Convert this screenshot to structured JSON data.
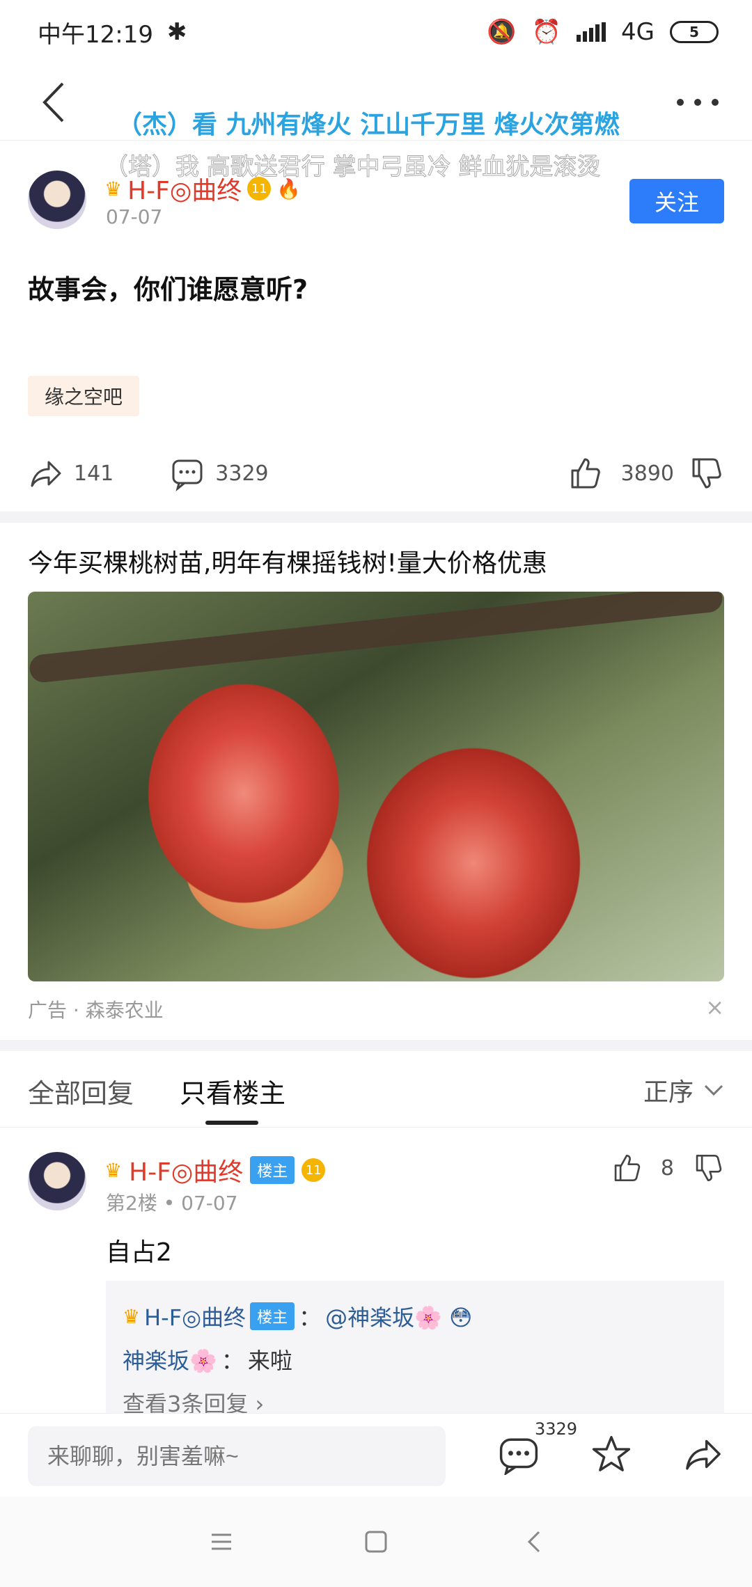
{
  "status": {
    "time": "中午12:19",
    "network": "4G",
    "battery": "5"
  },
  "danmaku": {
    "line1": "（杰）看 九州有烽火 江山千万里 烽火次第燃",
    "line2": "（塔）我 高歌送君行 掌中弓虽冷 鲜血犹是滚烫"
  },
  "post": {
    "author": "H-F◎曲终",
    "level": "11",
    "date": "07-07",
    "follow_label": "关注",
    "title": "故事会，你们谁愿意听?",
    "forum_tag": "缘之空吧",
    "shares": "141",
    "comments": "3329",
    "likes": "3890"
  },
  "ad": {
    "title": "今年买棵桃树苗,明年有棵摇钱树!量大价格优惠",
    "source": "广告 · 森泰农业",
    "close": "×"
  },
  "tabs": {
    "all": "全部回复",
    "owner_only": "只看楼主",
    "sort": "正序"
  },
  "reply": {
    "author": "H-F◎曲终",
    "badge": "楼主",
    "level": "11",
    "floor": "第2楼",
    "date": "07-07",
    "likes": "8",
    "content": "自占2",
    "sub": [
      {
        "user": "H-F◎曲终",
        "badge": "楼主",
        "text": "@神楽坂🌸 😳"
      },
      {
        "user": "神楽坂🌸",
        "text": "来啦"
      }
    ],
    "more": "查看3条回复 ›"
  },
  "bottom": {
    "placeholder": "来聊聊，别害羞嘛~",
    "comment_count": "3329"
  }
}
